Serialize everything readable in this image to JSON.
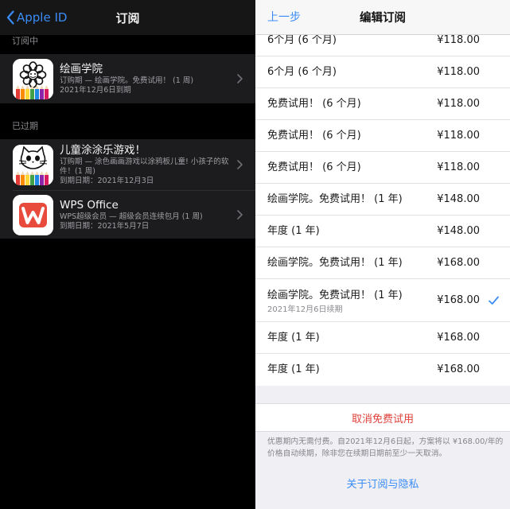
{
  "left": {
    "back_label": "Apple ID",
    "title": "订阅",
    "active_section": "订阅中",
    "expired_section": "已过期",
    "active_items": [
      {
        "name": "绘画学院",
        "line1": "订购期 — 绘画学院。免费试用！ (1 周)",
        "line2": "2021年12月6日到期",
        "icon": "flower-drawing-icon"
      }
    ],
    "expired_items": [
      {
        "name": "儿童涂涂乐游戏！",
        "line1": "订购期 — 涂色画画游戏以涂鸦板儿童! 小孩子的软件！(1 周)",
        "line2": "到期日期：2021年12月3日",
        "icon": "cat-drawing-icon"
      },
      {
        "name": "WPS Office",
        "line1": "WPS超级会员 — 超级会员连续包月 (1 周)",
        "line2": "到期日期：2021年5月7日",
        "icon": "wps-logo-icon"
      }
    ]
  },
  "right": {
    "back_label": "上一步",
    "title": "编辑订阅",
    "plans": [
      {
        "name": "6个月 (6 个月)",
        "price": "¥118.00"
      },
      {
        "name": "6个月 (6 个月)",
        "price": "¥118.00"
      },
      {
        "name": "免费试用！ (6 个月)",
        "price": "¥118.00"
      },
      {
        "name": "免费试用！ (6 个月)",
        "price": "¥118.00"
      },
      {
        "name": "免费试用！ (6 个月)",
        "price": "¥118.00"
      },
      {
        "name": "绘画学院。免费试用！ (1 年)",
        "price": "¥148.00"
      },
      {
        "name": "年度 (1 年)",
        "price": "¥148.00"
      },
      {
        "name": "绘画学院。免费试用！ (1 年)",
        "price": "¥168.00"
      },
      {
        "name": "绘画学院。免费试用！ (1 年)",
        "price": "¥168.00",
        "renew": "2021年12月6日续期",
        "selected": true
      },
      {
        "name": "年度 (1 年)",
        "price": "¥168.00"
      },
      {
        "name": "年度 (1 年)",
        "price": "¥168.00"
      }
    ],
    "cancel_label": "取消免费试用",
    "note": "优惠期内无需付费。自2021年12月6日起，方案将以 ¥168.00/年的价格自动续期，除非您在续期日期前至少一天取消。",
    "privacy_link": "关于订阅与隐私"
  },
  "colors": {
    "accent": "#3a8cf7",
    "destructive": "#e0413a",
    "wps_red": "#e84a3b"
  }
}
